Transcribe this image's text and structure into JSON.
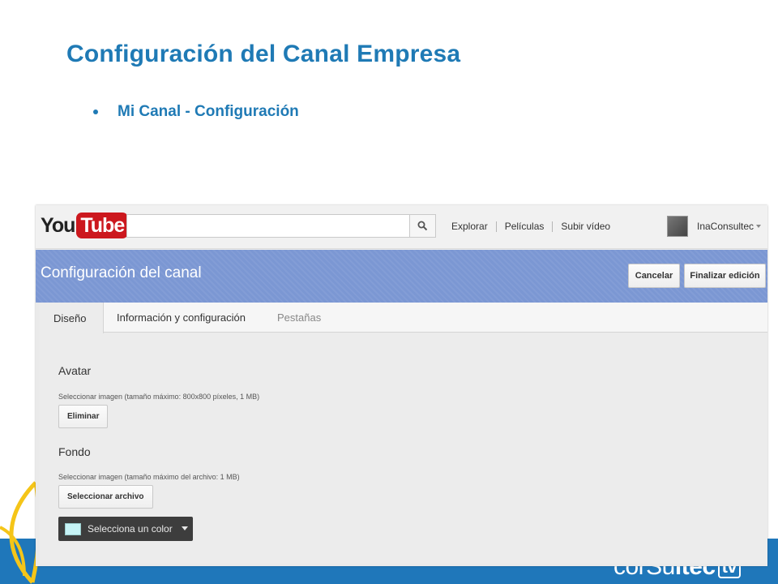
{
  "slide": {
    "title": "Configuración del Canal Empresa",
    "bullet": "Mi Canal - Configuración",
    "brand_prefix": "corSu",
    "brand_bold": "ltec",
    "brand_tv": "tv"
  },
  "youtube": {
    "logo_you": "You",
    "logo_tube": "Tube",
    "search_value": "",
    "nav": [
      "Explorar",
      "Películas",
      "Subir vídeo"
    ],
    "username": "InaConsultec"
  },
  "banner": {
    "title": "Configuración del canal",
    "cancel_label": "Cancelar",
    "finish_label": "Finalizar edición"
  },
  "tabs": [
    "Diseño",
    "Información y configuración",
    "Pestañas"
  ],
  "avatar_section": {
    "title": "Avatar",
    "hint": "Seleccionar imagen (tamaño máximo: 800x800 píxeles, 1 MB)",
    "button": "Eliminar"
  },
  "background_section": {
    "title": "Fondo",
    "hint": "Seleccionar imagen (tamaño máximo del archivo: 1 MB)",
    "button": "Seleccionar archivo",
    "color_label": "Selecciona un color",
    "color_value": "#c6f3f6"
  },
  "colors": {
    "accent": "#1f7ab5",
    "banner": "#7b97d3",
    "band": "#1f77ba",
    "leaf": "#f5c518"
  }
}
